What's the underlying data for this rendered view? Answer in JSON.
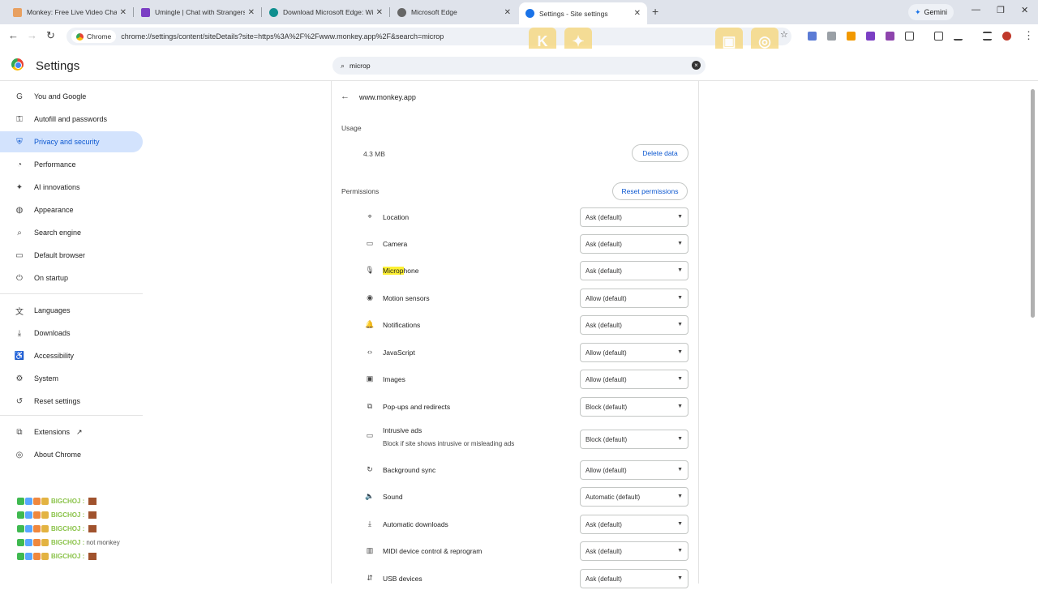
{
  "tabs": [
    {
      "title": "Monkey: Free Live Video Chat w",
      "color": "#e8a060"
    },
    {
      "title": "Umingle | Chat with Strangers |",
      "color": "#7b3fc4"
    },
    {
      "title": "Download Microsoft Edge: Win",
      "color": "#0f8f8f"
    },
    {
      "title": "Microsoft Edge",
      "color": "#666666"
    },
    {
      "title": "Settings - Site settings",
      "color": "#1a73e8"
    }
  ],
  "gemini_label": "Gemini",
  "omnibox": {
    "chip_label": "Chrome",
    "url": "chrome://settings/content/siteDetails?site=https%3A%2F%2Fwww.monkey.app%2F&search=microp"
  },
  "header": {
    "title": "Settings",
    "search_value": "microp"
  },
  "sidebar": {
    "items": [
      {
        "label": "You and Google",
        "icon": "G"
      },
      {
        "label": "Autofill and passwords",
        "icon": "⚿"
      },
      {
        "label": "Privacy and security",
        "icon": "⛨"
      },
      {
        "label": "Performance",
        "icon": "◔"
      },
      {
        "label": "AI innovations",
        "icon": "✦"
      },
      {
        "label": "Appearance",
        "icon": "◍"
      },
      {
        "label": "Search engine",
        "icon": "⌕"
      },
      {
        "label": "Default browser",
        "icon": "▭"
      },
      {
        "label": "On startup",
        "icon": "⏻"
      },
      {
        "label": "Languages",
        "icon": "文"
      },
      {
        "label": "Downloads",
        "icon": "⤓"
      },
      {
        "label": "Accessibility",
        "icon": "♿"
      },
      {
        "label": "System",
        "icon": "⚙"
      },
      {
        "label": "Reset settings",
        "icon": "↺"
      },
      {
        "label": "Extensions",
        "icon": "⧉"
      },
      {
        "label": "About Chrome",
        "icon": "◎"
      }
    ]
  },
  "chat_overlay": {
    "lines": [
      {
        "name": "BIGCHOJ :",
        "message": ""
      },
      {
        "name": "BIGCHOJ :",
        "message": ""
      },
      {
        "name": "BIGCHOJ :",
        "message": ""
      },
      {
        "name": "BIGCHOJ :",
        "message": "not monkey"
      },
      {
        "name": "BIGCHOJ :",
        "message": ""
      }
    ]
  },
  "site": {
    "name": "www.monkey.app",
    "usage_heading": "Usage",
    "usage_value": "4.3 MB",
    "delete_label": "Delete data",
    "permissions_heading": "Permissions",
    "reset_label": "Reset permissions",
    "permissions": [
      {
        "pre": "",
        "hl": "",
        "label": "Location",
        "sub": "",
        "value": "Ask (default)",
        "icon": "⌖"
      },
      {
        "pre": "",
        "hl": "",
        "label": "Camera",
        "sub": "",
        "value": "Ask (default)",
        "icon": "▭"
      },
      {
        "pre": "",
        "hl": "Microp",
        "label": "hone",
        "sub": "",
        "value": "Ask (default)",
        "icon": "🎙"
      },
      {
        "pre": "",
        "hl": "",
        "label": "Motion sensors",
        "sub": "",
        "value": "Allow (default)",
        "icon": "◉"
      },
      {
        "pre": "",
        "hl": "",
        "label": "Notifications",
        "sub": "",
        "value": "Ask (default)",
        "icon": "🔔"
      },
      {
        "pre": "",
        "hl": "",
        "label": "JavaScript",
        "sub": "",
        "value": "Allow (default)",
        "icon": "‹›"
      },
      {
        "pre": "",
        "hl": "",
        "label": "Images",
        "sub": "",
        "value": "Allow (default)",
        "icon": "▣"
      },
      {
        "pre": "",
        "hl": "",
        "label": "Pop-ups and redirects",
        "sub": "",
        "value": "Block (default)",
        "icon": "⧉"
      },
      {
        "pre": "",
        "hl": "",
        "label": "Intrusive ads",
        "sub": "Block if site shows intrusive or misleading ads",
        "value": "Block (default)",
        "icon": "▭"
      },
      {
        "pre": "",
        "hl": "",
        "label": "Background sync",
        "sub": "",
        "value": "Allow (default)",
        "icon": "↻"
      },
      {
        "pre": "",
        "hl": "",
        "label": "Sound",
        "sub": "",
        "value": "Automatic (default)",
        "icon": "🔈"
      },
      {
        "pre": "",
        "hl": "",
        "label": "Automatic downloads",
        "sub": "",
        "value": "Ask (default)",
        "icon": "⤓"
      },
      {
        "pre": "",
        "hl": "",
        "label": "MIDI device control & reprogram",
        "sub": "",
        "value": "Ask (default)",
        "icon": "▥"
      },
      {
        "pre": "",
        "hl": "",
        "label": "USB devices",
        "sub": "",
        "value": "Ask (default)",
        "icon": "⇵"
      }
    ]
  }
}
